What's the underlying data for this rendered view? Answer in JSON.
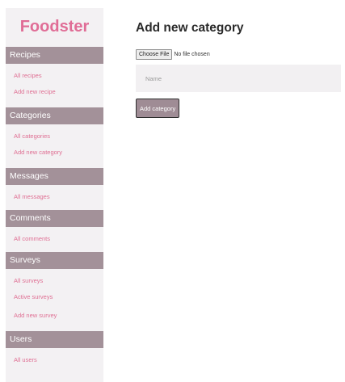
{
  "sidebar": {
    "brand": "Foodster",
    "sections": [
      {
        "header": "Recipes",
        "links": [
          "All recipes",
          "Add new recipe"
        ]
      },
      {
        "header": "Categories",
        "links": [
          "All categories",
          "Add new category"
        ]
      },
      {
        "header": "Messages",
        "links": [
          "All messages"
        ]
      },
      {
        "header": "Comments",
        "links": [
          "All comments"
        ]
      },
      {
        "header": "Surveys",
        "links": [
          "All surveys",
          "Active surveys",
          "Add new survey"
        ]
      },
      {
        "header": "Users",
        "links": [
          "All users"
        ]
      }
    ]
  },
  "main": {
    "title": "Add new category",
    "file": {
      "button_label": "Choose File",
      "status": "No file chosen"
    },
    "name_field": {
      "placeholder": "Name",
      "value": ""
    },
    "submit_label": "Add category"
  },
  "colors": {
    "brand": "#e06d96",
    "section_header_bg": "#a39199",
    "sidebar_bg": "#f3f1f3",
    "link": "#df6f93",
    "button_bg": "#9f8c95"
  }
}
